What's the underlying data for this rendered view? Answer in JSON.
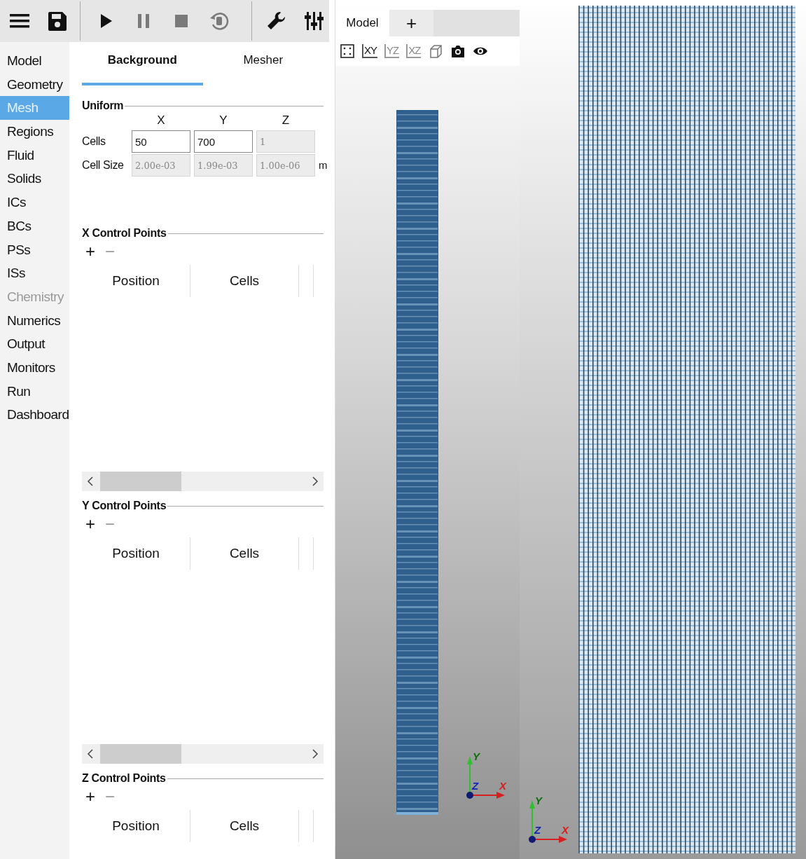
{
  "toolbar": {
    "groups": [
      [
        {
          "kind": "menu",
          "disabled": false
        },
        {
          "kind": "save",
          "disabled": false
        }
      ],
      [
        {
          "kind": "run",
          "disabled": false
        },
        {
          "kind": "pause",
          "disabled": true
        },
        {
          "kind": "stop",
          "disabled": true
        },
        {
          "kind": "reset",
          "disabled": true
        }
      ],
      [
        {
          "kind": "settings",
          "disabled": false
        },
        {
          "kind": "parameters",
          "disabled": false
        }
      ]
    ]
  },
  "sidebar": {
    "items": [
      {
        "label": "Model",
        "selected": false,
        "disabled": false
      },
      {
        "label": "Geometry",
        "selected": false,
        "disabled": false
      },
      {
        "label": "Mesh",
        "selected": true,
        "disabled": false
      },
      {
        "label": "Regions",
        "selected": false,
        "disabled": false
      },
      {
        "label": "Fluid",
        "selected": false,
        "disabled": false
      },
      {
        "label": "Solids",
        "selected": false,
        "disabled": false
      },
      {
        "label": "ICs",
        "selected": false,
        "disabled": false
      },
      {
        "label": "BCs",
        "selected": false,
        "disabled": false
      },
      {
        "label": "PSs",
        "selected": false,
        "disabled": false
      },
      {
        "label": "ISs",
        "selected": false,
        "disabled": false
      },
      {
        "label": "Chemistry",
        "selected": false,
        "disabled": true
      },
      {
        "label": "Numerics",
        "selected": false,
        "disabled": false
      },
      {
        "label": "Output",
        "selected": false,
        "disabled": false
      },
      {
        "label": "Monitors",
        "selected": false,
        "disabled": false
      },
      {
        "label": "Run",
        "selected": false,
        "disabled": false
      },
      {
        "label": "Dashboard",
        "selected": false,
        "disabled": false
      }
    ]
  },
  "tabs": [
    {
      "label": "Background",
      "selected": true
    },
    {
      "label": "Mesher",
      "selected": false
    }
  ],
  "uniform": {
    "title": "Uniform",
    "columns": [
      "X",
      "Y",
      "Z"
    ],
    "unit": "m",
    "rows": [
      {
        "label": "Cells",
        "fields": [
          {
            "value": "50",
            "disabled": false
          },
          {
            "value": "700",
            "disabled": false
          },
          {
            "value": "1",
            "disabled": true
          }
        ]
      },
      {
        "label": "Cell Size",
        "fields": [
          {
            "value": "2.00e-03",
            "disabled": true
          },
          {
            "value": "1.99e-03",
            "disabled": true
          },
          {
            "value": "1.00e-06",
            "disabled": true
          }
        ]
      }
    ]
  },
  "control_points": [
    {
      "title": "X Control Points",
      "add": "+",
      "remove": "−",
      "remove_disabled": true,
      "columns": [
        "Position",
        "Cells"
      ],
      "scrollbar": true
    },
    {
      "title": "Y Control Points",
      "add": "+",
      "remove": "−",
      "remove_disabled": true,
      "columns": [
        "Position",
        "Cells"
      ],
      "scrollbar": true
    },
    {
      "title": "Z Control Points",
      "add": "+",
      "remove": "−",
      "remove_disabled": true,
      "columns": [
        "Position",
        "Cells"
      ]
    }
  ],
  "viewer": {
    "tabs": [
      {
        "label": "Model",
        "selected": true
      },
      {
        "label": "+",
        "selected": false
      }
    ],
    "tools": [
      {
        "kind": "fit"
      },
      {
        "kind": "plane",
        "label": "XY",
        "active": true
      },
      {
        "kind": "plane",
        "label": "YZ",
        "active": false
      },
      {
        "kind": "plane",
        "label": "XZ",
        "active": false
      },
      {
        "kind": "perspective"
      },
      {
        "kind": "screenshot"
      },
      {
        "kind": "visibility"
      }
    ],
    "axes": {
      "x": "X",
      "y": "Y",
      "z": "Z"
    }
  },
  "mesh_closeup": {
    "axes": {
      "x": "X",
      "y": "Y",
      "z": "Z"
    }
  }
}
